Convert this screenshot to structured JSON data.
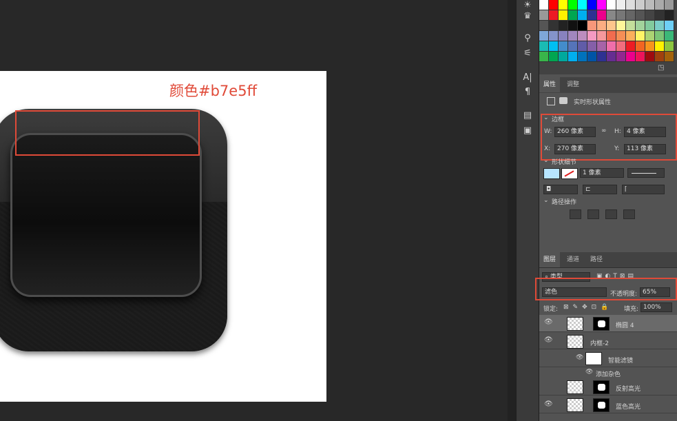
{
  "annotation": {
    "text": "颜色#b7e5ff"
  },
  "swatch_colors": [
    "#ffffff",
    "#ff0000",
    "#ffff00",
    "#00ff00",
    "#00ffff",
    "#0000ff",
    "#ff00ff",
    "#ffffff",
    "#eeeeee",
    "#dddddd",
    "#cccccc",
    "#bbbbbb",
    "#aaaaaa",
    "#999999",
    "#999999",
    "#ed1c24",
    "#fff200",
    "#00a651",
    "#00aeef",
    "#2e3192",
    "#ec008c",
    "#888888",
    "#777777",
    "#666666",
    "#555555",
    "#444444",
    "#333333",
    "#222222",
    "#555555",
    "#333333",
    "#222222",
    "#111111",
    "#000000",
    "#f7977a",
    "#fbad82",
    "#fdc68c",
    "#fff79a",
    "#c4df9b",
    "#a2d39c",
    "#82ca9d",
    "#7bcdc8",
    "#6ecff6",
    "#7ea7d8",
    "#8493ca",
    "#8882be",
    "#a187be",
    "#bc8dbf",
    "#f49ac2",
    "#f6989d",
    "#f26c4f",
    "#f68e56",
    "#fbaf5c",
    "#fff467",
    "#acd373",
    "#7cc576",
    "#3bb878",
    "#1abbb4",
    "#00bff3",
    "#438ccb",
    "#5574b9",
    "#605ca8",
    "#855fa8",
    "#a763a8",
    "#f06eaa",
    "#f26d7d",
    "#ed1c24",
    "#f26522",
    "#f7941d",
    "#fff200",
    "#8dc63f",
    "#39b54a",
    "#00a651",
    "#00a99d",
    "#00aeef",
    "#0072bc",
    "#0054a6",
    "#2e3192",
    "#662d91",
    "#92278f",
    "#ec008c",
    "#ed145b",
    "#9e0b0f",
    "#a0410d",
    "#a3620a"
  ],
  "properties_panel": {
    "tabs": [
      "属性",
      "调整"
    ],
    "shape_title": "实时形状属性",
    "bounds_section": "边框",
    "w_label": "W:",
    "w_value": "260 像素",
    "link_icon": "∞",
    "h_label": "H:",
    "h_value": "4 像素",
    "x_label": "X:",
    "x_value": "270 像素",
    "y_label": "Y:",
    "y_value": "113 像素",
    "shape_detail_section": "形状细节",
    "stroke_size": "1 像素",
    "path_ops_section": "路径操作"
  },
  "layers_panel": {
    "tabs": [
      "图层",
      "通道",
      "路径"
    ],
    "filter_label": "类型",
    "blend_mode": "滤色",
    "opacity_label": "不透明度:",
    "opacity_value": "65%",
    "lock_label": "锁定:",
    "fill_label": "填充:",
    "fill_value": "100%",
    "layers": [
      {
        "name": "椭圆 4"
      },
      {
        "name": "内框-2"
      },
      {
        "name": "智能滤镜"
      },
      {
        "name": "添加杂色"
      },
      {
        "name": "反射高光"
      },
      {
        "name": "蓝色高光"
      }
    ]
  },
  "icons": [
    "sun-icon",
    "crown-icon",
    "brush-icon",
    "sliders-icon",
    "character-icon",
    "paragraph-icon",
    "library-icon",
    "notes-icon"
  ]
}
